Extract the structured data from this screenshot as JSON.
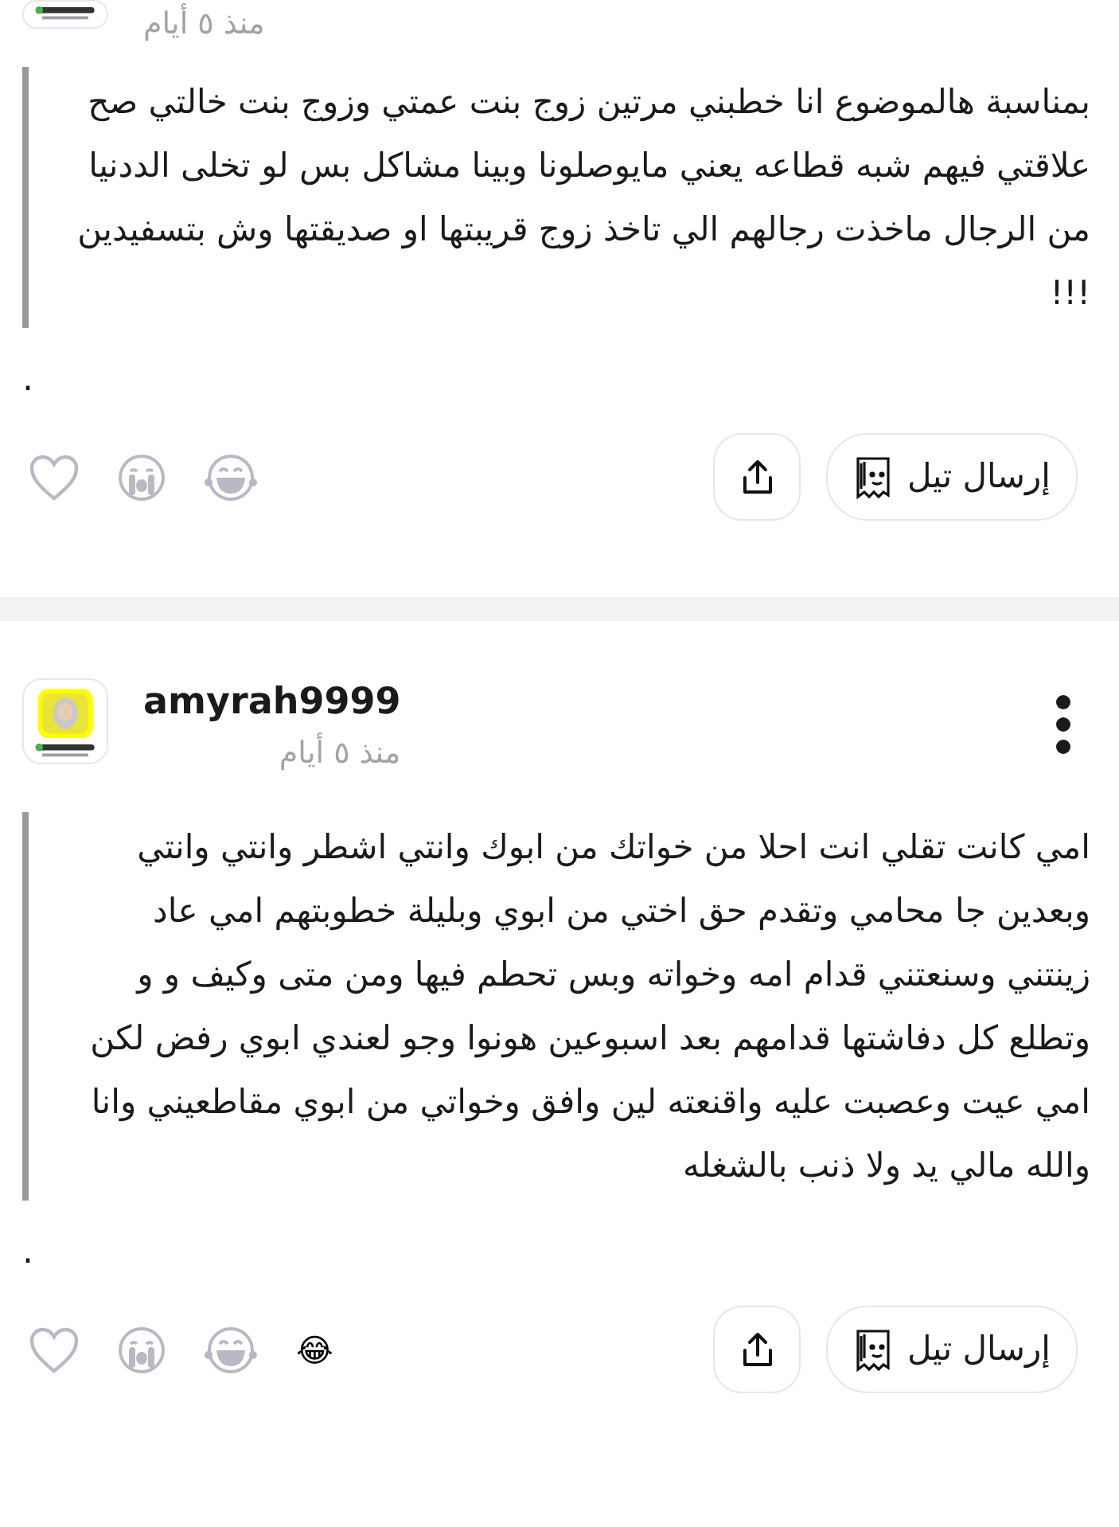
{
  "posts": [
    {
      "header": {
        "time": "منذ ٥ أيام"
      },
      "body": "بمناسبة هالموضوع انا خطبني مرتين زوج بنت عمتي وزوج بنت خالتي صح علاقتي فيهم شبه قطاعه يعني مايوصلونا وبينا مشاكل بس لو تخلى الددنيا من الرجال ماخذت رجالهم الي تاخذ زوج قريبتها او صديقتها وش بتسفيدين !!!",
      "trailer": ".",
      "reactions": [
        {
          "kind": "heart"
        },
        {
          "kind": "crying"
        },
        {
          "kind": "laughing"
        }
      ],
      "send_label": "إرسال تيل"
    },
    {
      "header": {
        "username": "amyrah9999",
        "time": "منذ ٥ أيام"
      },
      "body": "امي كانت تقلي انت احلا من خواتك من ابوك وانتي اشطر وانتي وانتي وبعدين جا محامي وتقدم حق اختي من ابوي وبليلة خطوبتهم امي عاد زينتني وسنعتني قدام امه وخواته وبس تحطم فيها ومن متى وكيف و و وتطلع كل دفاشتها قدامهم بعد اسبوعين هونوا وجو لعندي ابوي رفض لكن امي عيت وعصبت عليه واقنعته لين وافق وخواتي من ابوي مقاطعيني وانا والله مالي يد ولا ذنب بالشغله",
      "trailer": ".",
      "reactions": [
        {
          "kind": "heart"
        },
        {
          "kind": "crying"
        },
        {
          "kind": "laughing"
        }
      ],
      "my_reaction": "😂",
      "send_label": "إرسال تيل"
    }
  ]
}
